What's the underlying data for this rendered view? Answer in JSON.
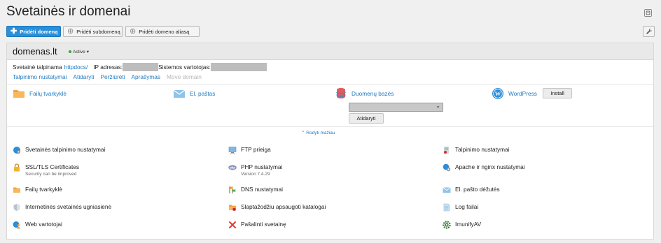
{
  "page": {
    "title": "Svetainės ir domenai"
  },
  "toolbar": {
    "add_domain": "Pridėti domeną",
    "add_subdomain": "Pridėti subdomeną",
    "add_alias": "Pridėti domeno aliasą"
  },
  "domain": {
    "name": "domenas.lt",
    "status": "Active",
    "hosting_label": "Svetainė talpinama",
    "hosting_dir": "httpdocs/",
    "ip_label": "IP adresas:",
    "user_label": "Sistemos vartotojas:",
    "links": [
      "Talpinimo nustatymai",
      "Atidaryti",
      "Peržiūrėti",
      "Aprašymas"
    ],
    "disabled_link": "Move domain"
  },
  "features": {
    "file_manager": "Failų tvarkyklė",
    "mail": "El. paštas",
    "databases": "Duomenų bazės",
    "wordpress": "WordPress",
    "install": "Install",
    "open": "Atidaryti"
  },
  "show_less": "Rodyti mažiau",
  "tools": {
    "c1": [
      {
        "name": "Svetainės talpinimo nustatymai"
      },
      {
        "name": "SSL/TLS Certificates",
        "sub": "Security can be improved"
      },
      {
        "name": "Failų tvarkyklė"
      },
      {
        "name": "Internetinės svetainės ugniasienė"
      },
      {
        "name": "Web vartotojai"
      }
    ],
    "c2": [
      {
        "name": "FTP prieiga"
      },
      {
        "name": "PHP nustatymai",
        "sub": "Version 7.4.29"
      },
      {
        "name": "DNS nustatymai"
      },
      {
        "name": "Slaptažodžiu apsaugoti katalogai"
      },
      {
        "name": "Pašalinti svetainę"
      }
    ],
    "c3": [
      {
        "name": "Talpinimo nustatymai"
      },
      {
        "name": "Apache ir nginx nustatymai"
      },
      {
        "name": "El. pašto dėžutės"
      },
      {
        "name": "Log failai"
      },
      {
        "name": "ImunifyAV"
      }
    ]
  },
  "colors": {
    "accent": "#2a8ed8",
    "link": "#1e7ac3",
    "status_active": "#3aa53a"
  }
}
